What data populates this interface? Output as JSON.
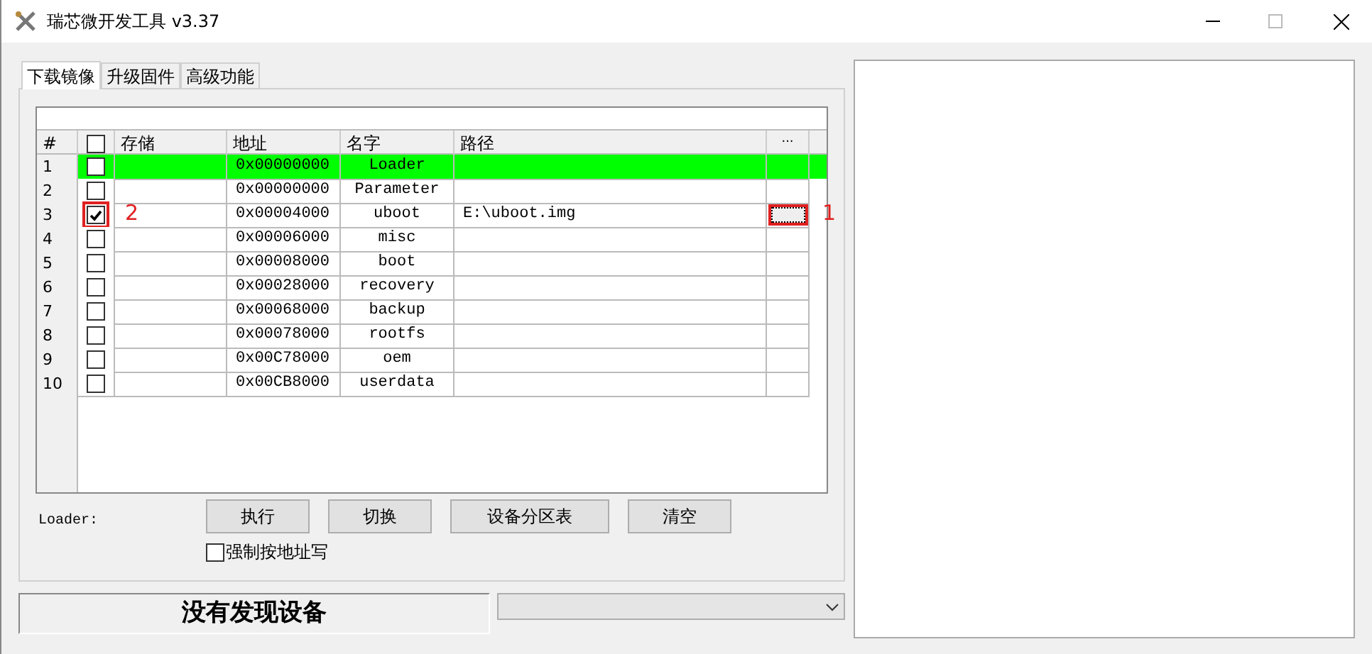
{
  "window": {
    "title": "瑞芯微开发工具 v3.37"
  },
  "tabs": [
    {
      "label": "下载镜像",
      "selected": true
    },
    {
      "label": "升级固件",
      "selected": false
    },
    {
      "label": "高级功能",
      "selected": false
    }
  ],
  "table": {
    "columns": [
      "#",
      "存储",
      "地址",
      "名字",
      "路径",
      "..."
    ],
    "header_checkbox": {
      "checked": false
    },
    "rows": [
      {
        "index": "1",
        "checked": false,
        "address": "0x00000000",
        "name": "Loader",
        "path": "",
        "selected": true
      },
      {
        "index": "2",
        "checked": false,
        "address": "0x00000000",
        "name": "Parameter",
        "path": "",
        "selected": false
      },
      {
        "index": "3",
        "checked": true,
        "address": "0x00004000",
        "name": "uboot",
        "path": "E:\\uboot.img",
        "selected": false,
        "checkbox_marker": "2",
        "browse_marker": "1"
      },
      {
        "index": "4",
        "checked": false,
        "address": "0x00006000",
        "name": "misc",
        "path": "",
        "selected": false
      },
      {
        "index": "5",
        "checked": false,
        "address": "0x00008000",
        "name": "boot",
        "path": "",
        "selected": false
      },
      {
        "index": "6",
        "checked": false,
        "address": "0x00028000",
        "name": "recovery",
        "path": "",
        "selected": false
      },
      {
        "index": "7",
        "checked": false,
        "address": "0x00068000",
        "name": "backup",
        "path": "",
        "selected": false
      },
      {
        "index": "8",
        "checked": false,
        "address": "0x00078000",
        "name": "rootfs",
        "path": "",
        "selected": false
      },
      {
        "index": "9",
        "checked": false,
        "address": "0x00C78000",
        "name": "oem",
        "path": "",
        "selected": false
      },
      {
        "index": "10",
        "checked": false,
        "address": "0x00CB8000",
        "name": "userdata",
        "path": "",
        "selected": false
      }
    ]
  },
  "loader_label": "Loader:",
  "buttons": [
    "执行",
    "切换",
    "设备分区表",
    "清空"
  ],
  "force_address_write": {
    "label": "强制按地址写",
    "checked": false
  },
  "status": "没有发现设备"
}
